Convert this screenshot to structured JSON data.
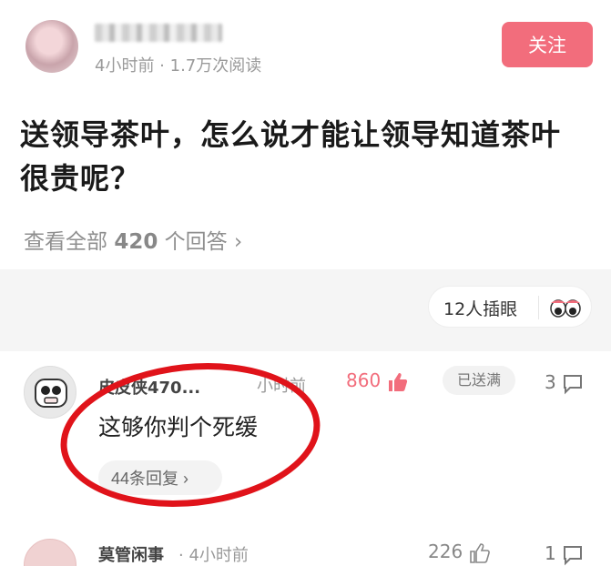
{
  "post": {
    "meta": "4小时前 · 1.7万次阅读",
    "follow_label": "关注"
  },
  "question": {
    "text": "送领导茶叶，怎么说才能让领导知道茶叶很贵呢？",
    "view_all_prefix": "查看全部",
    "answer_count": "420",
    "view_all_suffix": "个回答 ›"
  },
  "peek": {
    "label": "12人插眼"
  },
  "comments": [
    {
      "name": "皮皮侠470...",
      "time": "小时前",
      "likes": "860",
      "badge": "已送满",
      "replies": "3",
      "text": "这够你判个死缓",
      "reply_link": "44条回复 ›"
    },
    {
      "name": "莫管闲事",
      "time": "· 4小时前",
      "likes": "226",
      "replies": "1"
    }
  ],
  "colors": {
    "follow_bg": "#f26d7c",
    "like_accent": "#f26d7c",
    "annotation": "#e0131a"
  }
}
